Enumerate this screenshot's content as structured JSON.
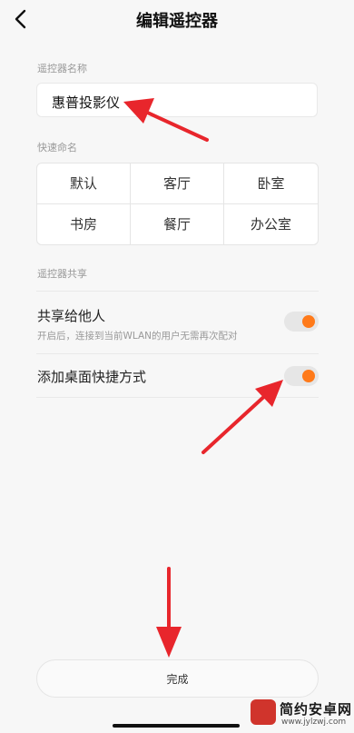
{
  "header": {
    "title": "编辑遥控器",
    "back_icon": "chevron-left-icon"
  },
  "name_section": {
    "label": "遥控器名称",
    "value": "惠普投影仪"
  },
  "quick_name": {
    "label": "快速命名",
    "options": [
      "默认",
      "客厅",
      "卧室",
      "书房",
      "餐厅",
      "办公室"
    ]
  },
  "share_section": {
    "label": "遥控器共享",
    "share_row": {
      "title": "共享给他人",
      "subtitle": "开启后，连接到当前WLAN的用户无需再次配对",
      "enabled": true
    },
    "shortcut_row": {
      "title": "添加桌面快捷方式",
      "enabled": true
    }
  },
  "footer": {
    "done_label": "完成"
  },
  "watermark": {
    "name": "简约安卓网",
    "url": "www.jylzwj.com"
  },
  "colors": {
    "accent": "#ff7a1a",
    "annotation_arrow": "#e8262c"
  }
}
